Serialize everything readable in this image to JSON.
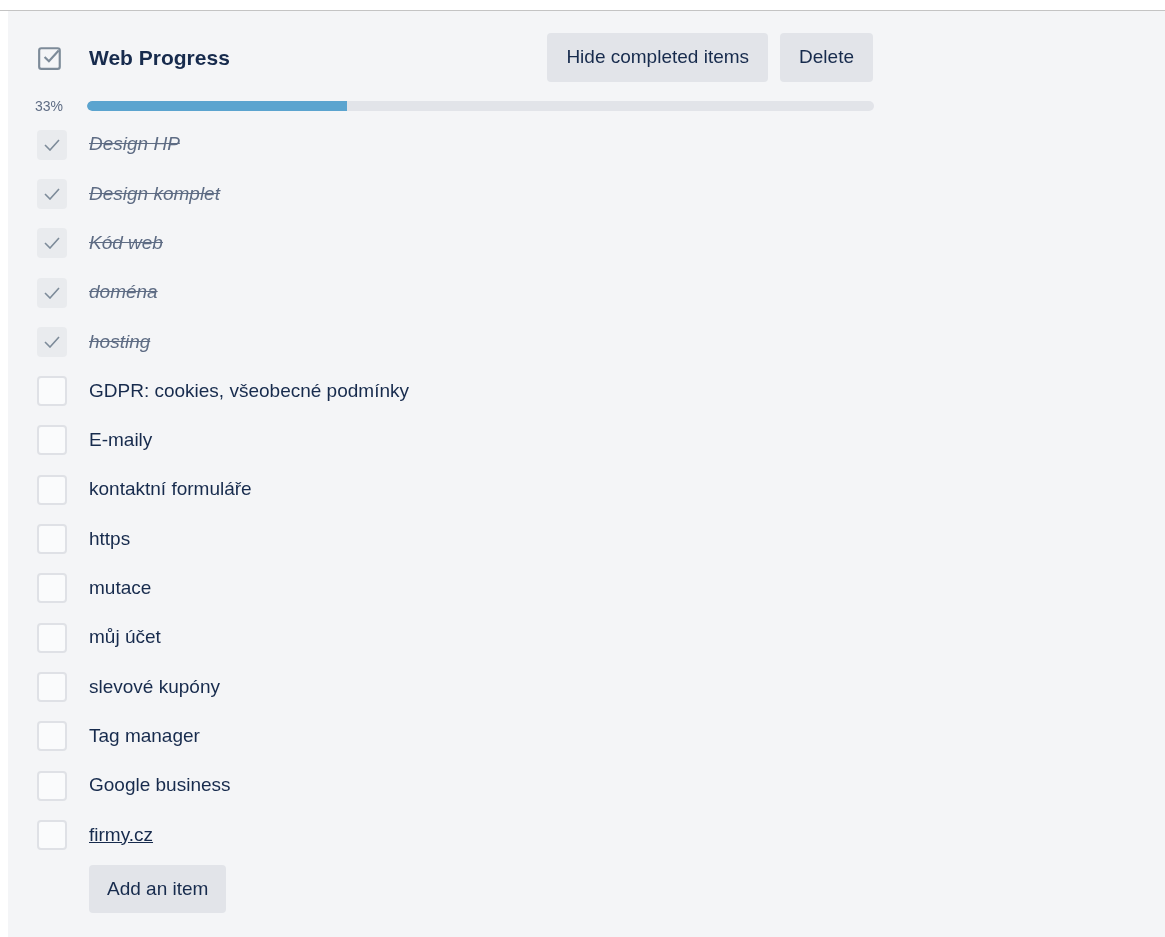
{
  "checklist": {
    "title": "Web Progress",
    "buttons": [
      "Hide completed items",
      "Delete"
    ],
    "progress": {
      "reading": "33%",
      "level": 0.33
    },
    "items": [
      {
        "text": "Design HP",
        "checked": true,
        "kind": "text"
      },
      {
        "text": "Design komplet",
        "checked": true,
        "kind": "text"
      },
      {
        "text": "Kód web",
        "checked": true,
        "kind": "text"
      },
      {
        "text": "doména",
        "checked": true,
        "kind": "text"
      },
      {
        "text": "hosting",
        "checked": true,
        "kind": "text"
      },
      {
        "text": "GDPR: cookies, všeobecné podmínky",
        "checked": false,
        "kind": "text"
      },
      {
        "text": "E-maily",
        "checked": false,
        "kind": "text"
      },
      {
        "text": "kontaktní formuláře",
        "checked": false,
        "kind": "text"
      },
      {
        "text": "https",
        "checked": false,
        "kind": "text"
      },
      {
        "text": "mutace",
        "checked": false,
        "kind": "text"
      },
      {
        "text": "můj účet",
        "checked": false,
        "kind": "text"
      },
      {
        "text": "slevové kupóny",
        "checked": false,
        "kind": "text"
      },
      {
        "text": "Tag manager",
        "checked": false,
        "kind": "text"
      },
      {
        "text": "Google business",
        "checked": false,
        "kind": "text"
      },
      {
        "text": "firmy.cz",
        "checked": false,
        "kind": "link"
      }
    ],
    "add_button": "Add an item"
  }
}
